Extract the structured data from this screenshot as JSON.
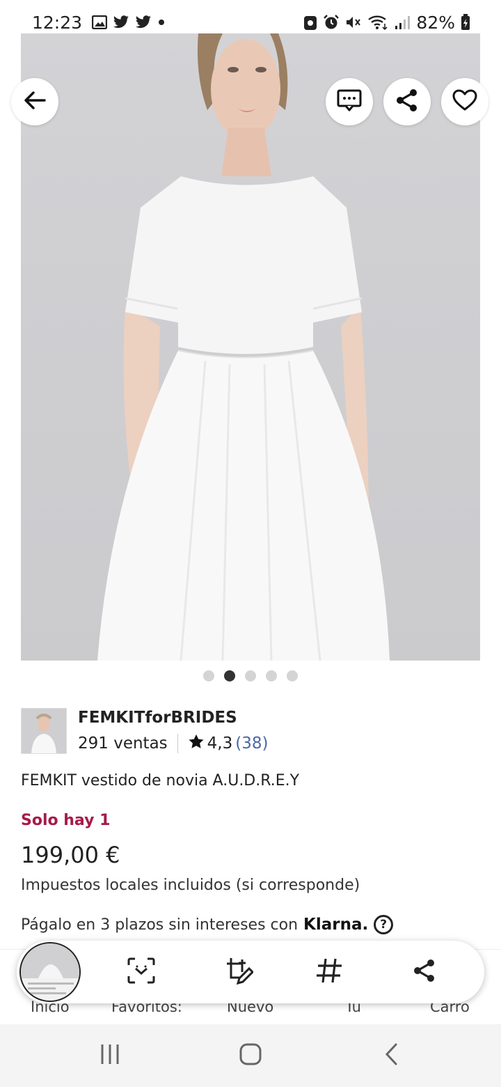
{
  "status_bar": {
    "time": "12:23",
    "battery": "82%",
    "left_icons": [
      "gallery-icon",
      "twitter-icon",
      "twitter-icon",
      "dot-icon"
    ],
    "right_icons": [
      "lock-icon",
      "alarm-icon",
      "mute-icon",
      "wifi-icon",
      "signal-icon",
      "battery-icon"
    ]
  },
  "hero": {
    "actions": [
      "back-icon",
      "message-icon",
      "share-icon",
      "heart-icon"
    ],
    "carousel": {
      "count": 5,
      "active_index": 1
    }
  },
  "shop": {
    "name": "FEMKITforBRIDES",
    "sales": "291 ventas",
    "rating": "4,3",
    "review_count": "(38)"
  },
  "product": {
    "title": "FEMKIT vestido de novia A.U.D.R.E.Y",
    "stock": "Solo hay 1",
    "price": "199,00 €",
    "tax_note": "Impuestos locales incluidos (si corresponde)",
    "installments_text": "Págalo en 3 plazos sin intereses con",
    "installments_brand": "Klarna.",
    "help": "?"
  },
  "bottom_nav": {
    "items": [
      "Inicio",
      "Favoritos:",
      "Nuevo",
      "Tú",
      "Carro"
    ]
  },
  "capture_toolbar": {
    "actions": [
      "scan-icon",
      "edit-crop-icon",
      "hashtag-icon",
      "share-icon"
    ]
  },
  "system_nav": {
    "buttons": [
      "recents-icon",
      "home-icon",
      "back-icon"
    ]
  },
  "colors": {
    "stock": "#a61a4b",
    "review_count": "#4a68a8",
    "hero_bg": "#cfcfd2"
  }
}
